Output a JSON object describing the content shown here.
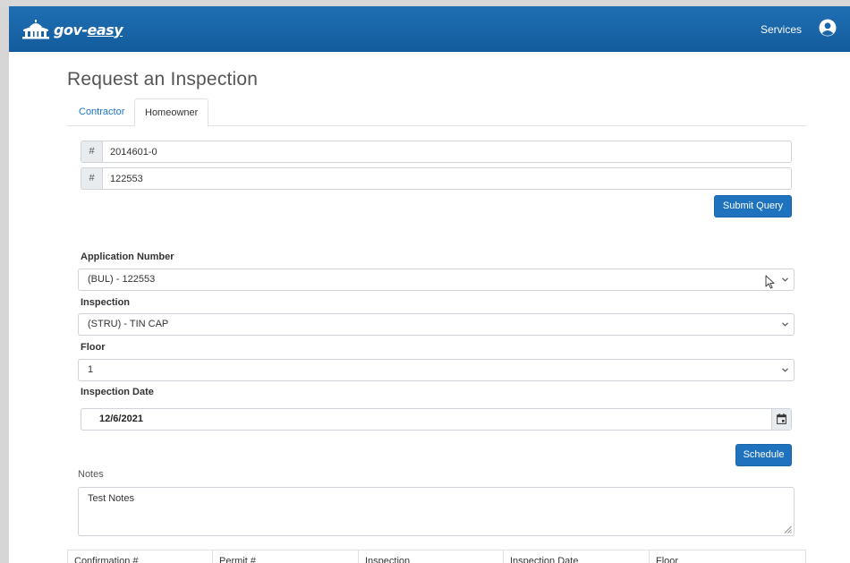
{
  "navbar": {
    "brand_prefix": "gov-",
    "brand_suffix": "easy",
    "services_label": "Services"
  },
  "page": {
    "title": "Request an Inspection"
  },
  "tabs": [
    {
      "label": "Contractor",
      "active": false
    },
    {
      "label": "Homeowner",
      "active": true
    }
  ],
  "query": {
    "addon_symbol": "#",
    "field1_value": "2014601-0",
    "field2_value": "122553",
    "submit_label": "Submit Query"
  },
  "form": {
    "application_label": "Application Number",
    "application_value": "(BUL) - 122553",
    "inspection_label": "Inspection",
    "inspection_value": "(STRU) - TIN CAP",
    "floor_label": "Floor",
    "floor_value": "1",
    "date_label": "Inspection Date",
    "date_value": "12/6/2021",
    "schedule_label": "Schedule",
    "notes_label": "Notes",
    "notes_value": "Test Notes"
  },
  "table": {
    "columns": [
      "Confirmation #",
      "Permit #",
      "Inspection",
      "Inspection Date",
      "Floor"
    ]
  },
  "colors": {
    "navbar": "#1a66aa",
    "primary_button": "#1f73be",
    "link": "#1a73c7"
  },
  "icons": {
    "brand": "capitol-building-icon",
    "user": "user-circle-icon",
    "calendar": "calendar-icon",
    "chevron": "chevron-down-icon"
  }
}
